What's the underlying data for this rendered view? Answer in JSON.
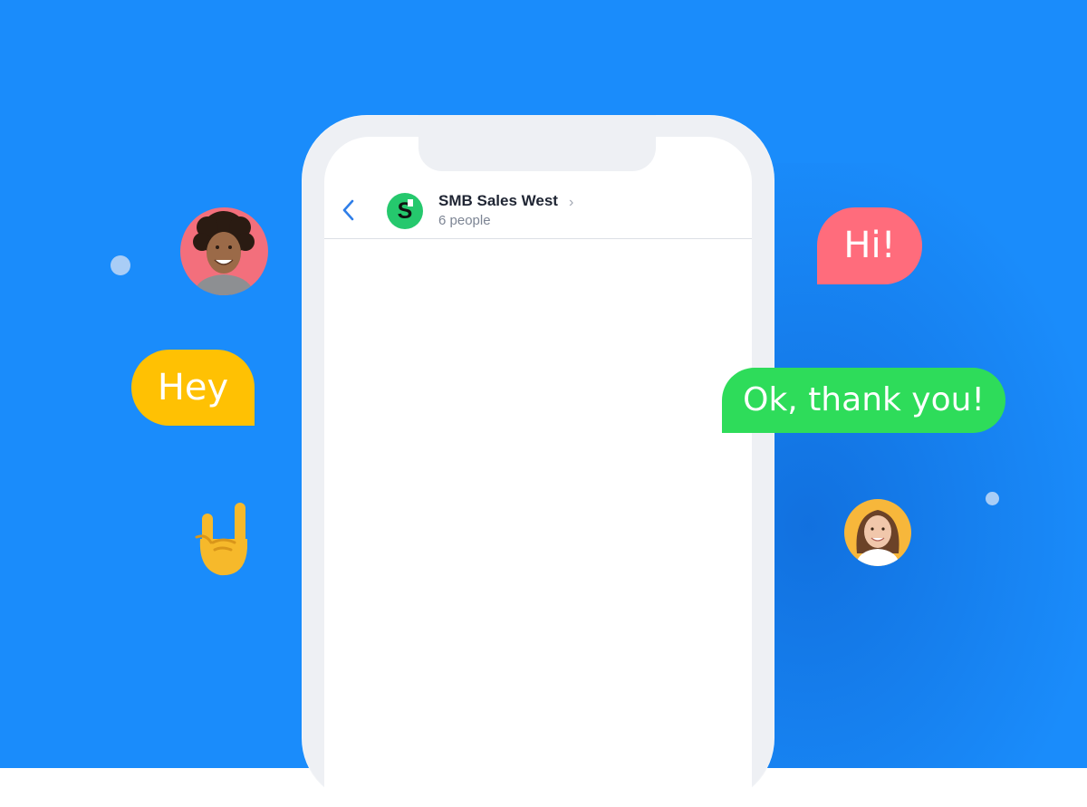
{
  "chat": {
    "group_name": "SMB Sales West",
    "member_count": "6 people",
    "group_initial": "S"
  },
  "bubbles": {
    "hey": "Hey",
    "hi": "Hi!",
    "ok": "Ok, thank you!"
  },
  "icons": {
    "back": "chevron-left-icon",
    "chevron": "chevron-right-icon",
    "rock_emoji": "rock-on-hand-emoji"
  },
  "colors": {
    "background": "#1a8cfb",
    "hey_bubble": "#ffc103",
    "hi_bubble": "#ff6c7c",
    "ok_bubble": "#2edc5a",
    "group_avatar": "#25c86d",
    "back_icon": "#2f7ee8"
  }
}
